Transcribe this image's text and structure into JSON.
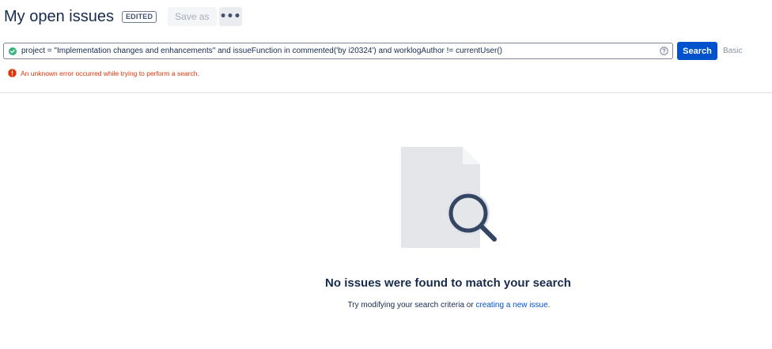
{
  "header": {
    "title": "My open issues",
    "edited_badge": "EDITED",
    "save_as_label": "Save as",
    "more_label": "•••"
  },
  "search": {
    "jql_parts": {
      "p1": "project = \"Implementation changes and enhancements\" and ",
      "p2": "issueFunction",
      "p3": " in commented('by ",
      "p4": "i20324",
      "p5": "') and ",
      "p6": "worklogAuthor",
      "p7": " != ",
      "p8": "currentUser",
      "p9": "()"
    },
    "search_button": "Search",
    "basic_link": "Basic",
    "error_message": "An unknown error occurred while trying to perform a search."
  },
  "empty_state": {
    "title": "No issues were found to match your search",
    "hint_prefix": "Try modifying your search criteria or ",
    "hint_link": "creating a new issue",
    "hint_suffix": "."
  },
  "icons": {
    "valid": "check-circle-icon",
    "help": "question-circle-icon",
    "error": "error-icon",
    "illustration": "document-search-illustration"
  },
  "colors": {
    "primary": "#0052cc",
    "error": "#de350b",
    "valid": "#36b37e",
    "text": "#172b4d"
  }
}
